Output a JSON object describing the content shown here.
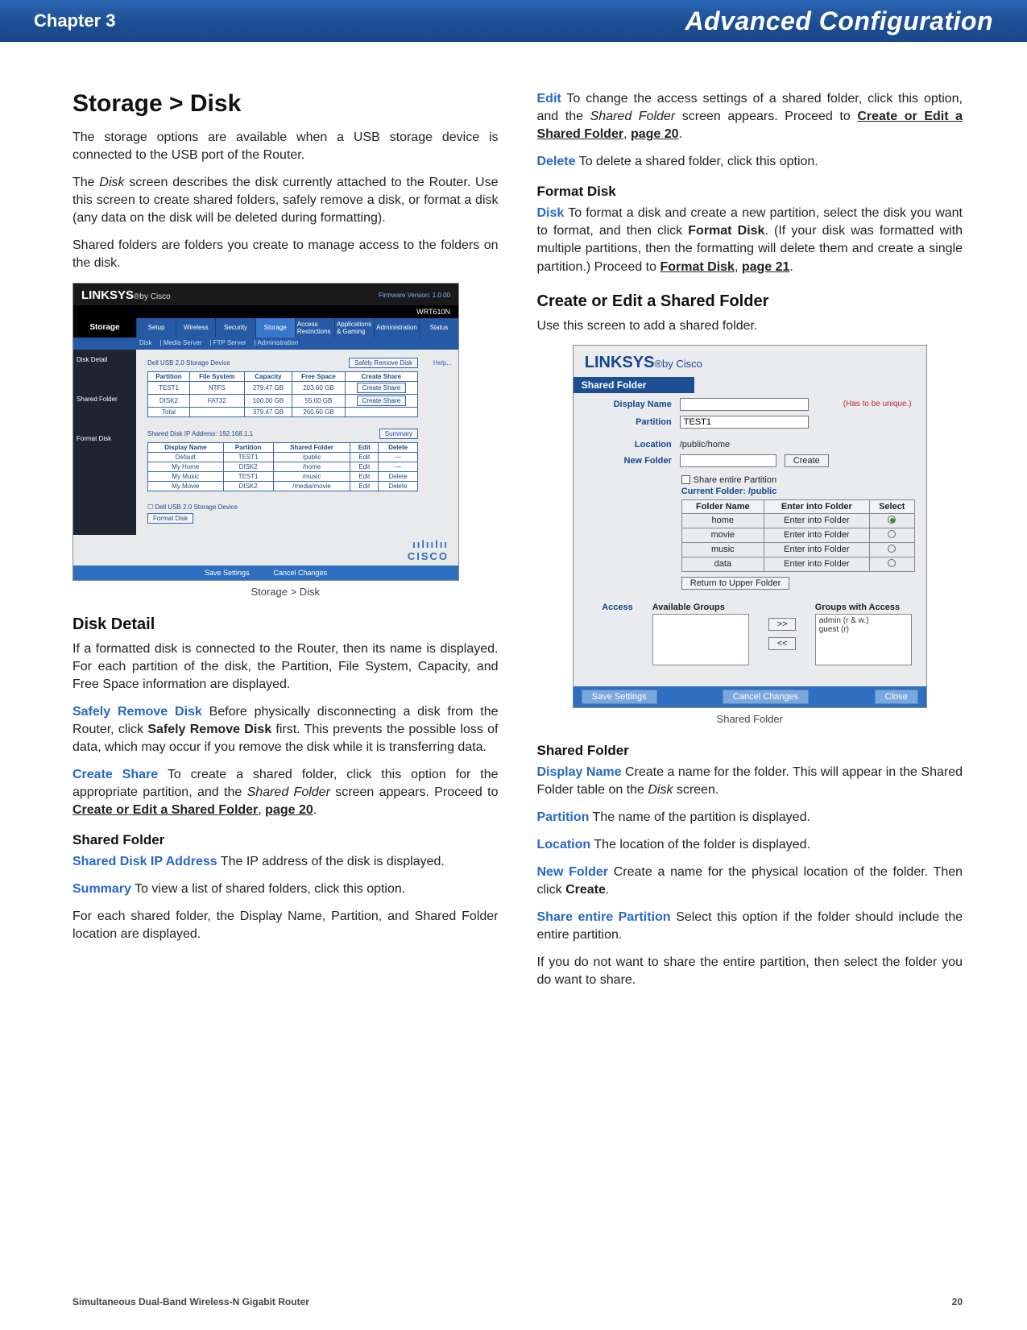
{
  "header": {
    "chapter": "Chapter 3",
    "title": "Advanced Configuration"
  },
  "left": {
    "h_storage_disk": "Storage > Disk",
    "p1_a": "The storage options are available when a USB storage device is connected to the USB port of the Router.",
    "p2_a": "The ",
    "p2_i": "Disk",
    "p2_b": " screen describes the disk currently attached to the Router. Use this screen to create shared folders, safely remove a disk, or format a disk (any data on the disk will be deleted during formatting).",
    "p3": "Shared folders are folders you create to manage access to the folders on the disk.",
    "caption1": "Storage > Disk",
    "h_disk_detail": "Disk Detail",
    "p4": "If a formatted disk is connected to the Router, then its name is displayed. For each partition of the disk, the Partition, File System, Capacity, and Free Space information are displayed.",
    "t_srd": "Safely Remove Disk",
    "p5_a": "  Before physically disconnecting a disk from the Router, click ",
    "p5_b": "Safely Remove Disk",
    "p5_c": " first. This prevents the possible loss of data, which may occur if you remove the disk while it is transferring data.",
    "t_cs": "Create Share",
    "p6_a": "  To create a shared folder, click this option for the appropriate partition, and the ",
    "p6_i": "Shared Folder",
    "p6_b": " screen appears. Proceed to ",
    "p6_u": "Create or Edit a Shared Folder",
    "p6_c": ", ",
    "p6_u2": "page 20",
    "p6_d": ".",
    "h_shared_folder": "Shared Folder",
    "t_sdip": "Shared Disk IP Address",
    "p7": "  The IP address of the disk is displayed.",
    "t_sum": "Summary",
    "p8": "  To view a list of shared folders, click this option.",
    "p9": "For each shared folder, the Display Name, Partition, and Shared Folder location are displayed."
  },
  "right": {
    "t_edit": "Edit",
    "p_edit_a": "  To change the access settings of a shared folder, click this option, and the ",
    "p_edit_i": "Shared Folder",
    "p_edit_b": " screen appears. Proceed to ",
    "p_edit_u1": "Create or Edit a Shared Folder",
    "p_edit_c": ", ",
    "p_edit_u2": "page 20",
    "p_edit_d": ".",
    "t_del": "Delete",
    "p_del": "  To delete a shared folder, click this option.",
    "h_format": "Format Disk",
    "t_disk": "Disk",
    "p_fd_a": "  To format a disk and create a new partition, select the disk you want to format, and then click ",
    "p_fd_b": "Format Disk",
    "p_fd_c": ". (If your disk was formatted with multiple partitions, then the formatting will delete them and create a single partition.) Proceed to ",
    "p_fd_u1": "Format Disk",
    "p_fd_d": ", ",
    "p_fd_u2": "page 21",
    "p_fd_e": ".",
    "h_cesf": "Create or Edit a Shared Folder",
    "p_cesf": "Use this screen to add a shared folder.",
    "caption2": "Shared Folder",
    "h_sf2": "Shared Folder",
    "t_dn": "Display Name",
    "p_dn_a": "  Create a name for the folder. This will appear in the Shared Folder table on the ",
    "p_dn_i": "Disk",
    "p_dn_b": " screen.",
    "t_part": "Partition",
    "p_part": "  The name of the partition is displayed.",
    "t_loc": "Location",
    "p_loc": "  The location of the folder is displayed.",
    "t_nf": "New Folder",
    "p_nf_a": "  Create a name for the physical location of the folder. Then click ",
    "p_nf_b": "Create",
    "p_nf_c": ".",
    "t_sep": "Share entire Partition",
    "p_sep": "  Select this option if the folder should include the entire partition.",
    "p_last": "If you do not want to share the entire partition, then select the folder you do want to share."
  },
  "shot1": {
    "logo_main": "LINKSYS",
    "logo_sub": "®by Cisco",
    "fw": "Firmware Version: 1.0.00",
    "model": "WRT610N",
    "sidelabel": "Storage",
    "tabs": [
      "Setup",
      "Wireless",
      "Security",
      "Storage",
      "Access Restrictions",
      "Applications & Gaming",
      "Administration",
      "Status"
    ],
    "subtabs": [
      "Disk",
      "Media Server",
      "FTP Server",
      "Administration"
    ],
    "sidemenu": [
      "Disk Detail",
      "Shared Folder",
      "Format Disk"
    ],
    "help": "Help...",
    "devlabel": "Dell USB 2.0 Storage Device",
    "srd_btn": "Safely Remove Disk",
    "t1_head": [
      "Partition",
      "File System",
      "Capacity",
      "Free Space",
      "Create Share"
    ],
    "t1_rows": [
      [
        "TEST1",
        "NTFS",
        "279.47 GB",
        "203.60 GB",
        "Create Share"
      ],
      [
        "DISK2",
        "FAT32",
        "100.00 GB",
        "55.00 GB",
        "Create Share"
      ],
      [
        "Total",
        "",
        "379.47 GB",
        "260.60 GB",
        ""
      ]
    ],
    "sf_hdr_a": "Shared Disk IP Address: 192.168.1.1",
    "summary_btn": "Summary",
    "t2_head": [
      "Display Name",
      "Partition",
      "Shared Folder",
      "Edit",
      "Delete"
    ],
    "t2_rows": [
      [
        "Default",
        "TEST1",
        "/public",
        "Edit",
        "—"
      ],
      [
        "My Home",
        "DISK2",
        "/home",
        "Edit",
        "—"
      ],
      [
        "My Music",
        "TEST1",
        "/music",
        "Edit",
        "Delete"
      ],
      [
        "My Movie",
        "DISK2",
        "/media/movie",
        "Edit",
        "Delete"
      ]
    ],
    "fd_dev": "Dell USB 2.0 Storage Device",
    "fd_btn": "Format Disk",
    "foot_save": "Save Settings",
    "foot_cancel": "Cancel Changes",
    "cisco": "CISCO"
  },
  "shot2": {
    "logo_main": "LINKSYS",
    "logo_sub": "®by Cisco",
    "hdr": "Shared Folder",
    "rows": {
      "display": "Display Name",
      "partition_lbl": "Partition",
      "partition_val": "TEST1",
      "location_lbl": "Location",
      "location_val": "/public/home",
      "new_folder": "New Folder",
      "create_btn": "Create",
      "hint": "(Has to be unique.)",
      "chk_label": "Share entire Partition",
      "curf_label": "Current Folder: ",
      "curf_val": "/public"
    },
    "ft_head": [
      "Folder Name",
      "Enter into Folder",
      "Select"
    ],
    "ft_rows": [
      [
        "home",
        "Enter into Folder",
        "on"
      ],
      [
        "movie",
        "Enter into Folder",
        "off"
      ],
      [
        "music",
        "Enter into Folder",
        "off"
      ],
      [
        "data",
        "Enter into Folder",
        "off"
      ]
    ],
    "ret_btn": "Return to Upper Folder",
    "access_lbl": "Access",
    "box1_title": "Available Groups",
    "box2_title": "Groups with Access",
    "box2_lines": "admin (r & w.)\nguest (r)",
    "arrow_r": ">>",
    "arrow_l": "<<",
    "foot_save": "Save Settings",
    "foot_cancel": "Cancel Changes",
    "foot_close": "Close"
  },
  "footer": {
    "product": "Simultaneous Dual-Band Wireless-N Gigabit Router",
    "page": "20"
  }
}
